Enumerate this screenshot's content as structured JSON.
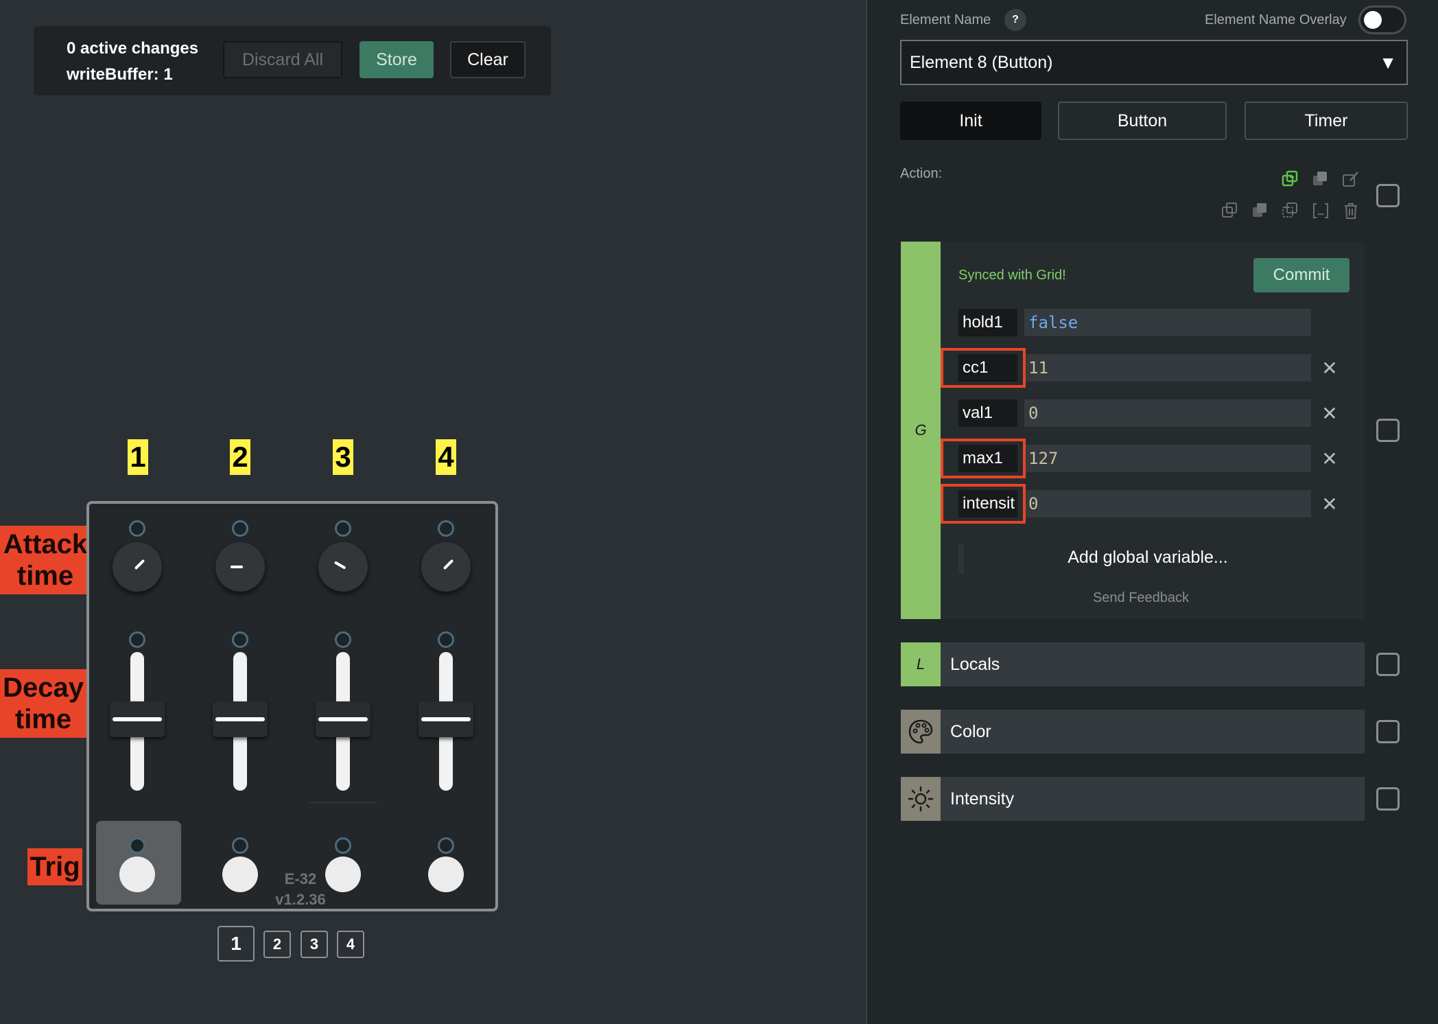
{
  "changes": {
    "active_changes": "0 active changes",
    "write_buffer": "writeBuffer: 1",
    "discard_label": "Discard All",
    "store_label": "Store",
    "clear_label": "Clear"
  },
  "module": {
    "columns": [
      "1",
      "2",
      "3",
      "4"
    ],
    "row_labels": {
      "attack": "Attack time",
      "decay": "Decay time",
      "trig": "Trig"
    },
    "name": "E-32",
    "version": "v1.2.36",
    "knob_angles_deg": [
      45,
      -90,
      -60,
      45
    ],
    "selected_button": "1"
  },
  "pages": [
    "1",
    "2",
    "3",
    "4"
  ],
  "right": {
    "element_name_label": "Element Name",
    "help": "?",
    "overlay_label": "Element Name Overlay",
    "overlay_on": false,
    "selected_element": "Element 8 (Button)",
    "tabs": [
      "Init",
      "Button",
      "Timer"
    ],
    "action_label": "Action:",
    "global": {
      "tab_letter": "G",
      "synced": "Synced with Grid!",
      "commit_label": "Commit",
      "variables": [
        {
          "name": "hold1",
          "value": "false",
          "highlighted": false,
          "removable": false
        },
        {
          "name": "cc1",
          "value": "11",
          "highlighted": true,
          "removable": true
        },
        {
          "name": "val1",
          "value": "0",
          "highlighted": false,
          "removable": true
        },
        {
          "name": "max1",
          "value": "127",
          "highlighted": true,
          "removable": true
        },
        {
          "name": "intensit",
          "value": "0",
          "highlighted": true,
          "removable": true
        }
      ],
      "remove_glyph": "✕",
      "add_variable": "Add global variable...",
      "feedback": "Send Feedback"
    },
    "blocks": [
      {
        "label": "Locals",
        "icon": "locals-icon",
        "letter": "L"
      },
      {
        "label": "Color",
        "icon": "palette-icon"
      },
      {
        "label": "Intensity",
        "icon": "sun-icon"
      }
    ]
  },
  "colors": {
    "accent_green": "#3d7a63",
    "global_tab": "#8cc26a",
    "highlight_red": "#e8442a",
    "column_yellow": "#fff34a"
  }
}
